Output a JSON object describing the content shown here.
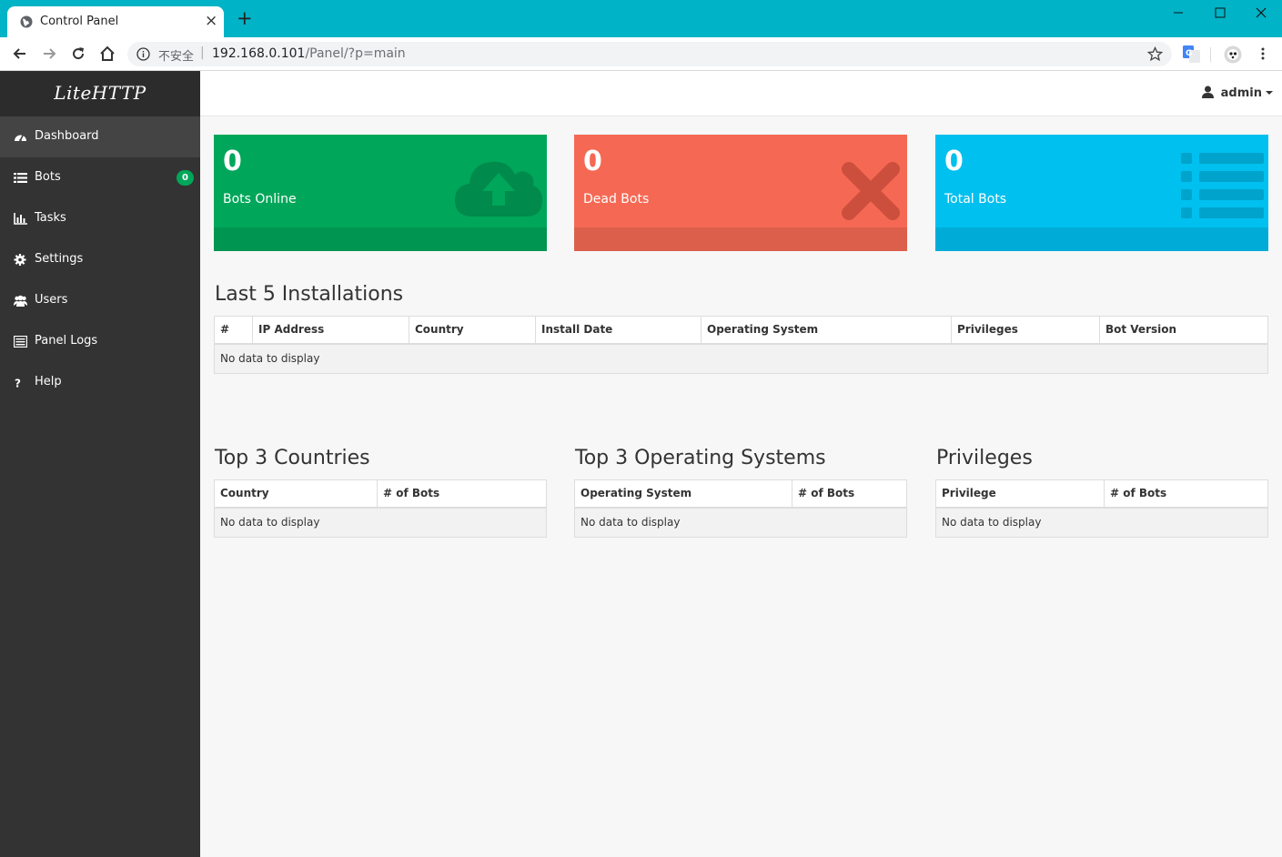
{
  "browser": {
    "tab_title": "Control Panel",
    "security_label": "不安全",
    "url_host": "192.168.0.101",
    "url_path": "/Panel/?p=main"
  },
  "sidebar": {
    "brand": "LiteHTTP",
    "items": [
      {
        "label": "Dashboard",
        "icon": "dashboard-icon"
      },
      {
        "label": "Bots",
        "icon": "list-icon",
        "badge": "0"
      },
      {
        "label": "Tasks",
        "icon": "bar-chart-icon"
      },
      {
        "label": "Settings",
        "icon": "gear-icon"
      },
      {
        "label": "Users",
        "icon": "users-icon"
      },
      {
        "label": "Panel Logs",
        "icon": "logs-icon"
      },
      {
        "label": "Help",
        "icon": "question-icon"
      }
    ]
  },
  "header": {
    "user": "admin"
  },
  "stats": [
    {
      "value": "0",
      "label": "Bots Online",
      "color": "#00a65a",
      "icon": "cloud-upload-icon"
    },
    {
      "value": "0",
      "label": "Dead Bots",
      "color": "#f56954",
      "icon": "x-icon"
    },
    {
      "value": "0",
      "label": "Total Bots",
      "color": "#00c0ef",
      "icon": "list-icon"
    }
  ],
  "installations": {
    "title": "Last 5 Installations",
    "columns": [
      "#",
      "IP Address",
      "Country",
      "Install Date",
      "Operating System",
      "Privileges",
      "Bot Version"
    ],
    "empty": "No data to display"
  },
  "countries": {
    "title": "Top 3 Countries",
    "columns": [
      "Country",
      "# of Bots"
    ],
    "empty": "No data to display"
  },
  "os": {
    "title": "Top 3 Operating Systems",
    "columns": [
      "Operating System",
      "# of Bots"
    ],
    "empty": "No data to display"
  },
  "privileges": {
    "title": "Privileges",
    "columns": [
      "Privilege",
      "# of Bots"
    ],
    "empty": "No data to display"
  }
}
